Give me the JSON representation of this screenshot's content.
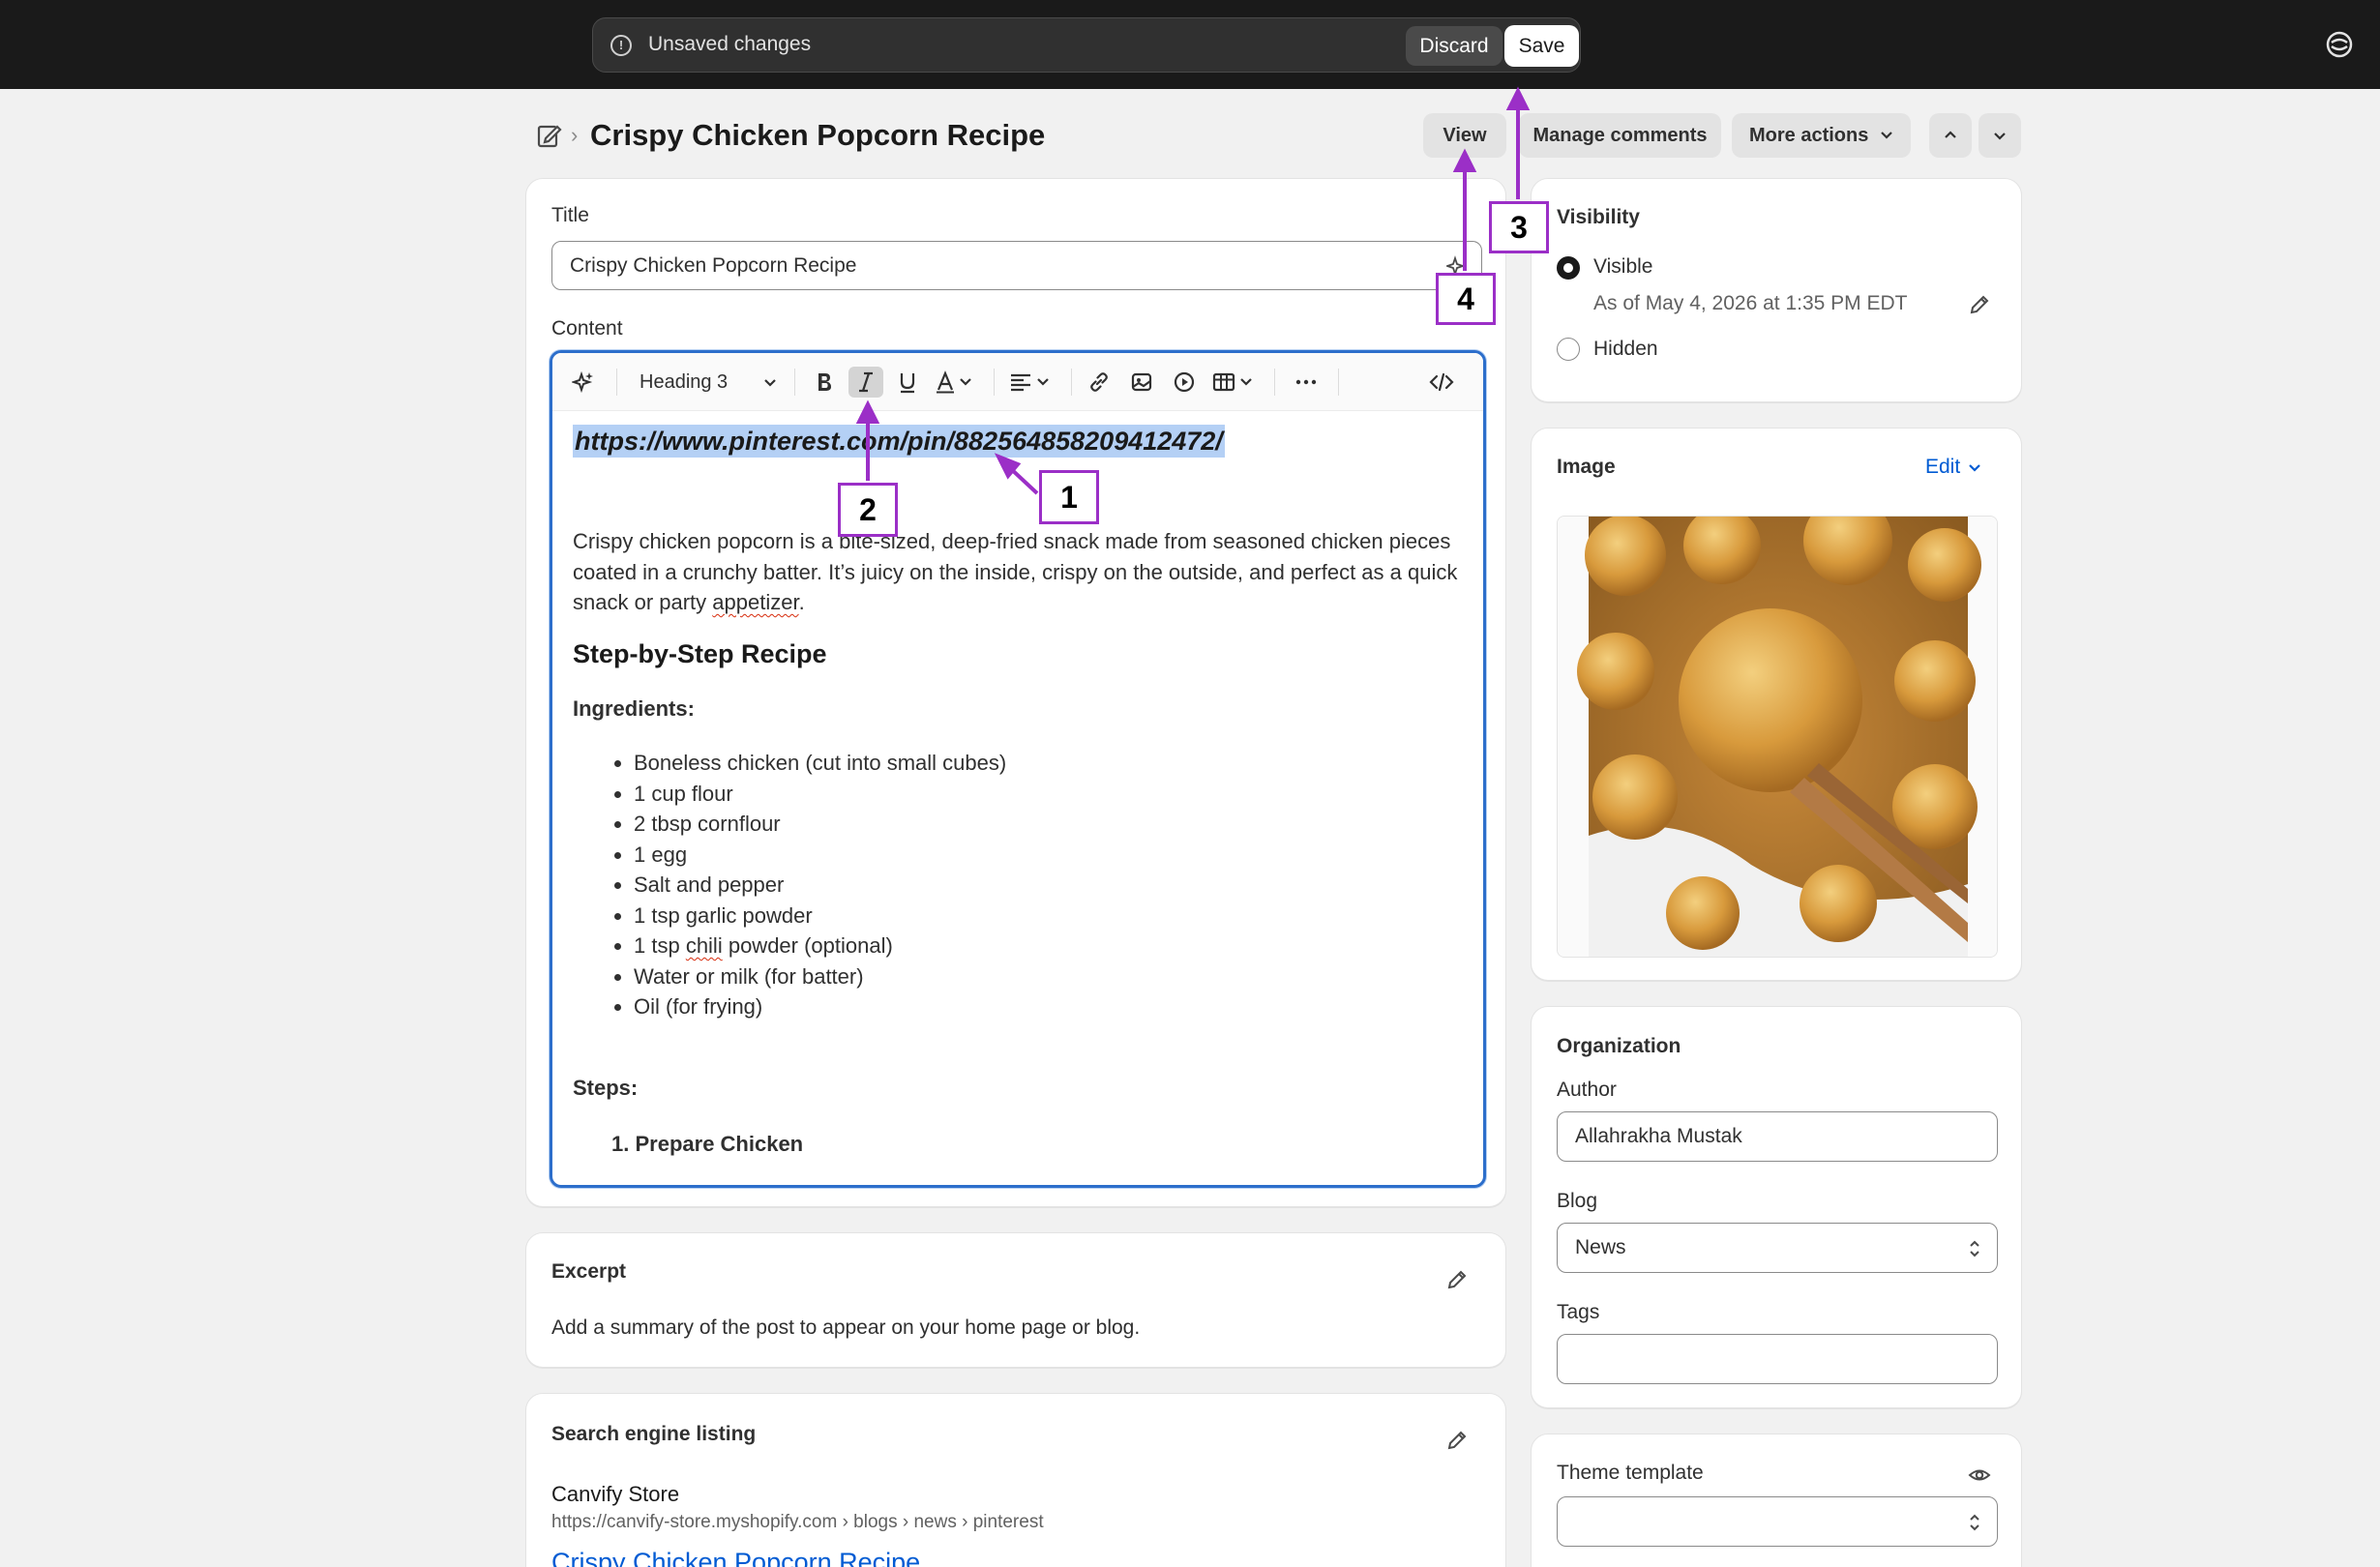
{
  "topbar": {
    "unsaved_text": "Unsaved changes",
    "discard_label": "Discard",
    "save_label": "Save"
  },
  "header": {
    "title": "Crispy Chicken Popcorn Recipe",
    "view_label": "View",
    "manage_comments_label": "Manage comments",
    "more_actions_label": "More actions"
  },
  "main": {
    "title_label": "Title",
    "title_value": "Crispy Chicken Popcorn Recipe",
    "content_label": "Content",
    "editor": {
      "heading_select": "Heading 3",
      "url_text": "https://www.pinterest.com/pin/882564858209412472/",
      "paragraph_before": "Crispy chicken popcorn is a bite-sized, deep-fried snack made from seasoned chicken pieces coated in a crunchy batter. It’s juicy on the inside, crispy on the outside, and perfect as a quick snack or party ",
      "paragraph_word": "appetizer",
      "paragraph_after": ".",
      "heading": "Step-by-Step Recipe",
      "ingredients_label": "Ingredients:",
      "ingredients": [
        "Boneless chicken (cut into small cubes)",
        "1 cup flour",
        "2 tbsp cornflour",
        "1 egg",
        "Salt and pepper",
        "1 tsp garlic powder",
        "1 tsp chili powder (optional)",
        "Water or milk (for batter)",
        "Oil (for frying)"
      ],
      "steps_label": "Steps:",
      "step_1_num": "1.",
      "step_1": "Prepare Chicken"
    },
    "excerpt": {
      "title": "Excerpt",
      "text": "Add a summary of the post to appear on your home page or blog."
    },
    "seo": {
      "title": "Search engine listing",
      "store": "Canvify Store",
      "url": "https://canvify-store.myshopify.com › blogs › news › pinterest",
      "link_title": "Crispy Chicken Popcorn Recipe"
    }
  },
  "sidebar": {
    "visibility": {
      "title": "Visibility",
      "visible_label": "Visible",
      "visible_date": "As of May 4, 2026 at 1:35 PM EDT",
      "hidden_label": "Hidden"
    },
    "image": {
      "title": "Image",
      "edit_label": "Edit"
    },
    "organization": {
      "title": "Organization",
      "author_label": "Author",
      "author_value": "Allahrakha Mustak",
      "blog_label": "Blog",
      "blog_value": "News",
      "tags_label": "Tags",
      "tags_value": ""
    },
    "theme": {
      "title": "Theme template",
      "value": ""
    }
  },
  "annotations": [
    "1",
    "2",
    "3",
    "4"
  ],
  "colors": {
    "accent": "#9b2fc7",
    "selection": "#b4d0f5",
    "link": "#005bd3",
    "topbar": "#1a1a1a"
  }
}
